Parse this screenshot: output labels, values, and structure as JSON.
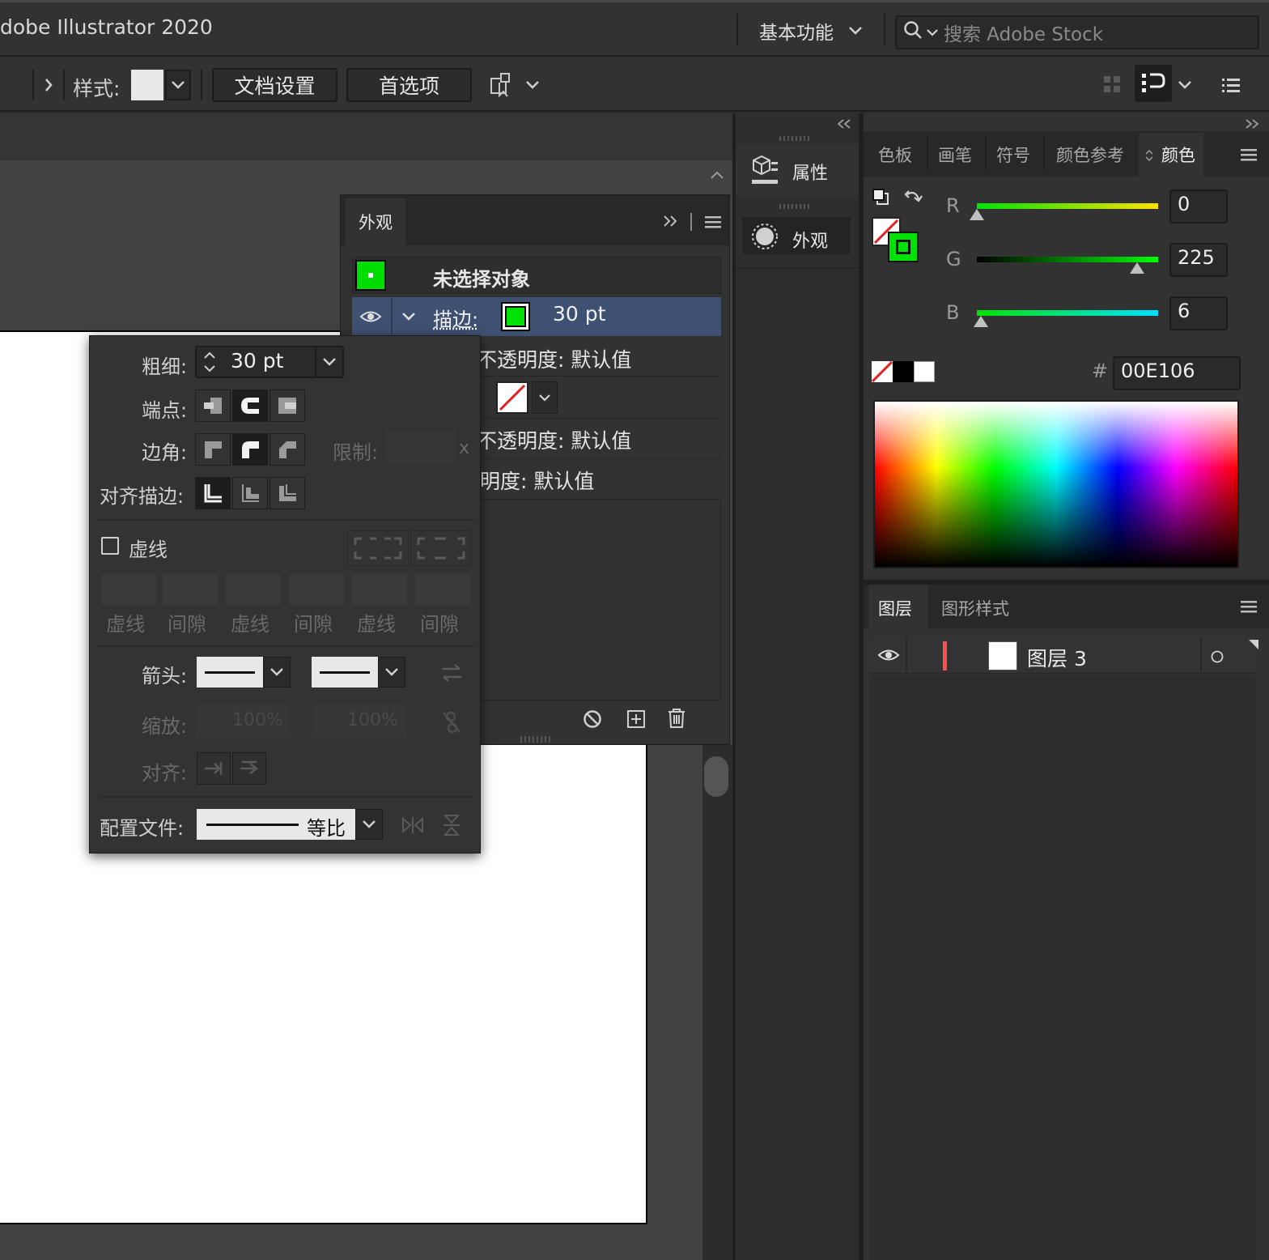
{
  "titlebar": {
    "app_title": "dobe Illustrator 2020",
    "workspace_label": "基本功能",
    "search_placeholder": "搜索 Adobe Stock"
  },
  "toolbar": {
    "style_label": "样式:",
    "doc_setup_label": "文档设置",
    "preferences_label": "首选项"
  },
  "panel_tabs": {
    "properties_label": "属性",
    "appearance_label": "外观"
  },
  "appearance_panel": {
    "tab_label": "外观",
    "header": "未选择对象",
    "stroke_label": "描边:",
    "stroke_weight": "30 pt",
    "opacity_row1": "不透明度: 默认值",
    "opacity_row2": "不透明度: 默认值",
    "opacity_row3": "明度: 默认值"
  },
  "stroke_popup": {
    "weight_label": "粗细:",
    "weight_value": "30 pt",
    "cap_label": "端点:",
    "corner_label": "边角:",
    "limit_label": "限制:",
    "limit_unit": "x",
    "align_label": "对齐描边:",
    "dashed_label": "虚线",
    "dash_fields": [
      "虚线",
      "间隙",
      "虚线",
      "间隙",
      "虚线",
      "间隙"
    ],
    "arrow_label": "箭头:",
    "scale_label": "缩放:",
    "scale_value1": "100%",
    "scale_value2": "100%",
    "align_arrow_label": "对齐:",
    "profile_label": "配置文件:",
    "profile_value": "等比"
  },
  "color_panel": {
    "tabs": [
      "色板",
      "画笔",
      "符号",
      "颜色参考",
      "颜色"
    ],
    "active_tab": "颜色",
    "r_label": "R",
    "r_value": "0",
    "g_label": "G",
    "g_value": "225",
    "b_label": "B",
    "b_value": "6",
    "r_level": 0.0,
    "g_level": 0.882,
    "b_level": 0.024,
    "hex_label": "#",
    "hex_value": "00E106",
    "stroke_color": "#00E106"
  },
  "layers_panel": {
    "tabs": [
      "图层",
      "图形样式"
    ],
    "active_tab": "图层",
    "layer_name": "图层 3",
    "layer_color": "#ff4f4f"
  }
}
